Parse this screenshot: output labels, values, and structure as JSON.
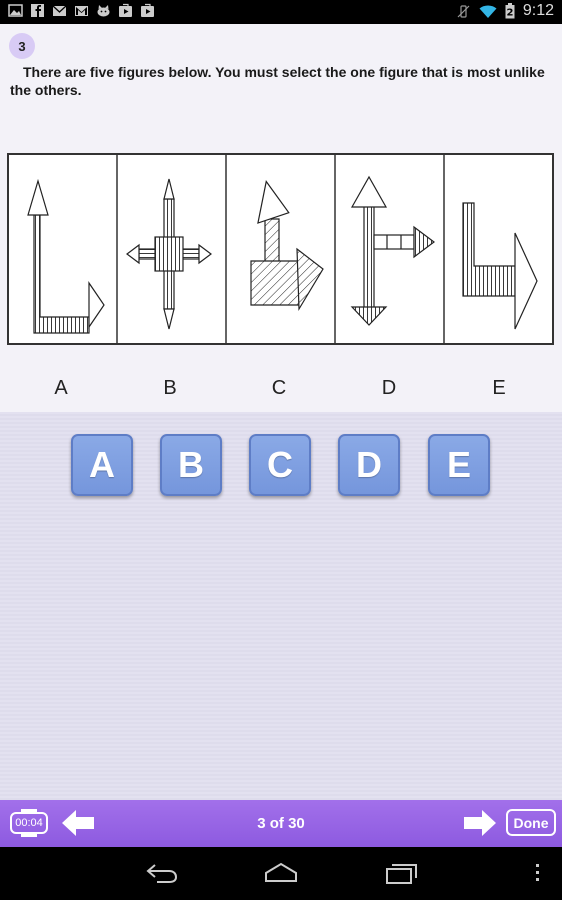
{
  "status_bar": {
    "time": "9:12",
    "left_icons": [
      "image-icon",
      "facebook-icon",
      "mail-icon",
      "gmail-icon",
      "android-cat-icon",
      "play-store-icon",
      "play-store-icon"
    ],
    "right_icons": [
      "vibrate-off-icon",
      "wifi-icon",
      "battery-icon"
    ]
  },
  "question": {
    "number": "3",
    "text": "There are five figures below.  You must select the one figure  that is most unlike the others.",
    "figure_labels": [
      "A",
      "B",
      "C",
      "D",
      "E"
    ]
  },
  "answers": [
    "A",
    "B",
    "C",
    "D",
    "E"
  ],
  "toolbar": {
    "timer": "00:04",
    "counter": "3 of 30",
    "done_label": "Done"
  },
  "colors": {
    "toolbar": "#9764e6",
    "answer_button": "#7d9de0",
    "question_badge": "#d8cbf5"
  }
}
